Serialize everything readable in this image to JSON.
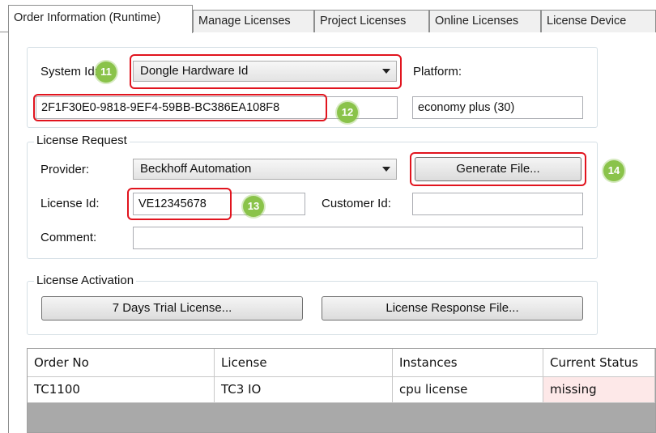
{
  "tabs": [
    {
      "label": "Order Information (Runtime)"
    },
    {
      "label": "Manage Licenses"
    },
    {
      "label": "Project Licenses"
    },
    {
      "label": "Online Licenses"
    },
    {
      "label": "License Device"
    }
  ],
  "system": {
    "system_id_label": "System Id:",
    "system_id_type": "Dongle Hardware Id",
    "system_id_value": "2F1F30E0-9818-9EF4-59BB-BC386EA108F8",
    "platform_label": "Platform:",
    "platform_value": "economy plus (30)"
  },
  "license_request": {
    "legend": "License Request",
    "provider_label": "Provider:",
    "provider_value": "Beckhoff Automation",
    "generate_button": "Generate File...",
    "license_id_label": "License Id:",
    "license_id_value": "VE12345678",
    "customer_id_label": "Customer Id:",
    "customer_id_value": "",
    "comment_label": "Comment:",
    "comment_value": ""
  },
  "license_activation": {
    "legend": "License Activation",
    "trial_button": "7 Days Trial License...",
    "response_button": "License Response File..."
  },
  "callouts": {
    "c11": "11",
    "c12": "12",
    "c13": "13",
    "c14": "14"
  },
  "table": {
    "columns": [
      "Order No",
      "License",
      "Instances",
      "Current Status"
    ],
    "rows": [
      [
        "TC1100",
        "TC3 IO",
        "cpu license",
        "missing"
      ]
    ]
  },
  "colors": {
    "callout_red": "#e1141e",
    "callout_green": "#8ac34a",
    "missing_status_bg": "#fde8e8"
  }
}
